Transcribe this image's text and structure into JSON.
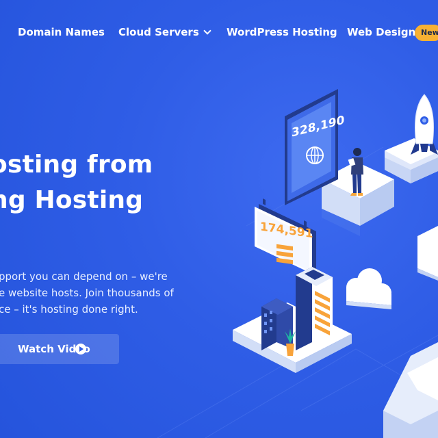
{
  "nav": {
    "items": [
      {
        "label": "Domain Names"
      },
      {
        "label": "Cloud Servers"
      },
      {
        "label": "WordPress Hosting"
      },
      {
        "label": "Web Design"
      }
    ],
    "badge": "New"
  },
  "hero": {
    "title_line1": "osting from",
    "title_line2": "ng Hosting",
    "body_line1": "pport you can depend on – we're",
    "body_line2": "e website hosts. Join thousands of",
    "body_line3": "ce – it's hosting done right.",
    "cta_label": "Watch Video"
  },
  "illustration": {
    "tablet_stat": "328,190",
    "billboard_stat": "174,591"
  },
  "colors": {
    "background": "#2f5de6",
    "badge": "#f8b133",
    "stat_orange": "#f8a33a"
  }
}
